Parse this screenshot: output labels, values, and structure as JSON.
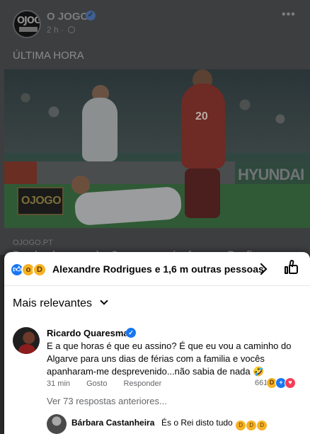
{
  "post": {
    "page_name": "O JOGO",
    "logo_text": "OJOGO",
    "time": "2 h",
    "separator": "·",
    "more": "•••",
    "text": "ÚLTIMA HORA",
    "photo": {
      "shirt_number": "20",
      "sponsor": "HYUNDAI",
      "watermark": "OJOGO"
    },
    "source": "OJOGO.PT",
    "headline_peek": "Bomba de mercado: Quaresma vai reforçar o Benfica..."
  },
  "reactions": {
    "icons": [
      "like-icon",
      "wow-icon",
      "haha-icon"
    ],
    "summary": "Alexandre Rodrigues e 1,6 m outras pessoas"
  },
  "sort": {
    "label": "Mais relevantes"
  },
  "comment": {
    "author": "Ricardo Quaresma",
    "text": "E a que horas é que eu assino? É que eu vou a caminho do Algarve para uns dias de férias com a familia e vocês apanharam-me desprevenido...não sabia de nada 🤣",
    "time": "31 min",
    "like_label": "Gosto",
    "reply_label": "Responder",
    "reaction_count": "661",
    "reaction_icons": [
      "haha-icon",
      "like-icon",
      "love-icon"
    ]
  },
  "replies": {
    "link": "Ver 73 respostas anteriores...",
    "latest": {
      "author": "Bárbara Castanheira",
      "text": "És o Rei disto tudo"
    }
  },
  "colors": {
    "accent": "#1877f2",
    "love": "#f33e58",
    "emoji": "#f7b125",
    "text_primary": "#050505",
    "text_secondary": "#65676b"
  }
}
